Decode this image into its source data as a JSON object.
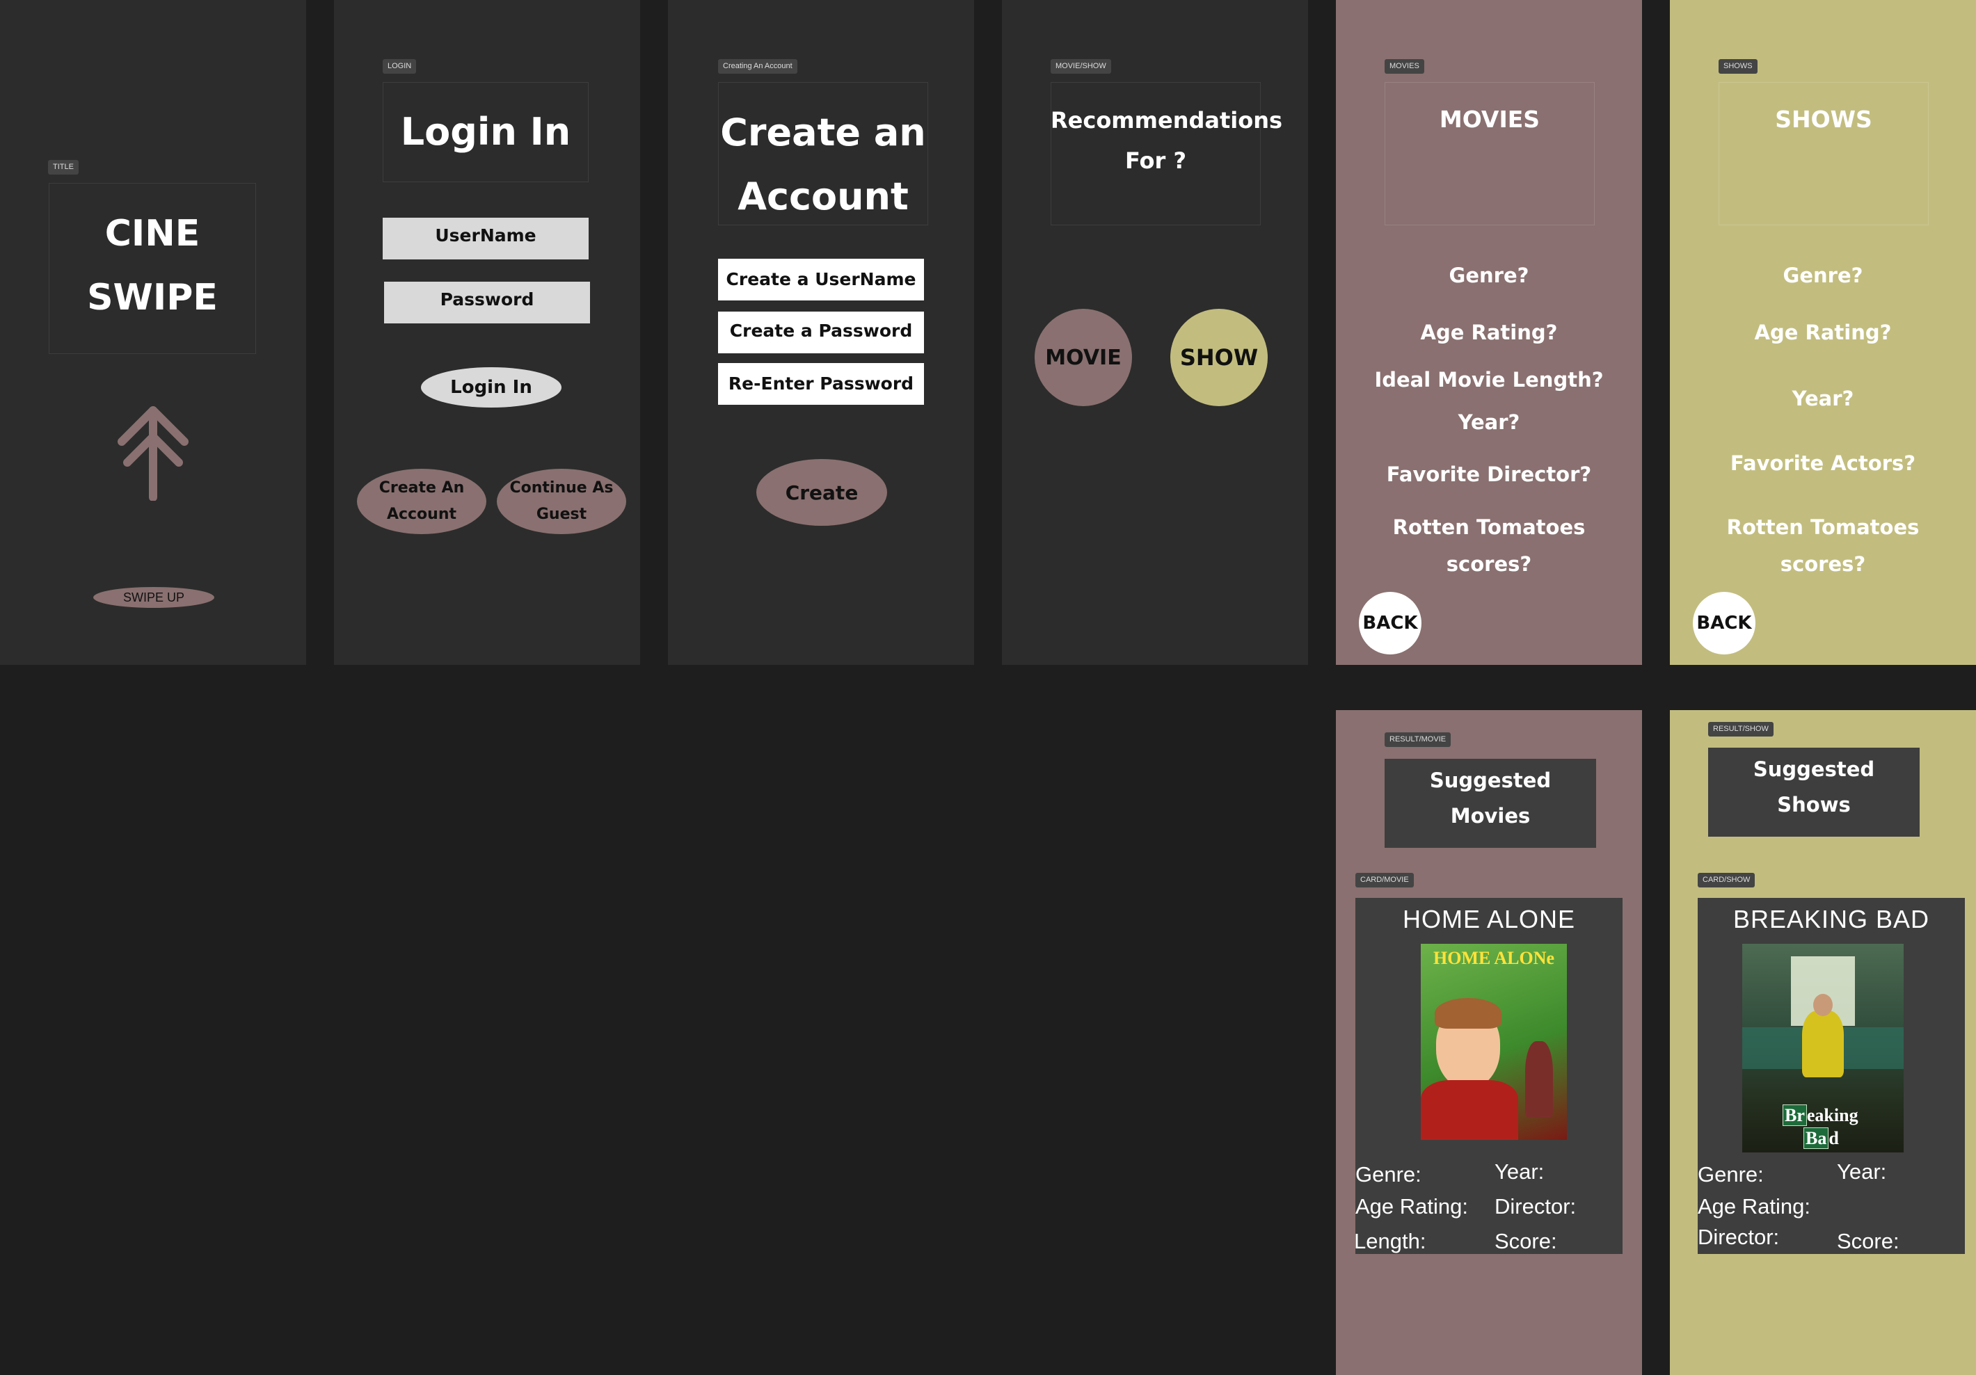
{
  "frames": {
    "title": {
      "tag": "TITLE",
      "heading": "CINE\nSWIPE",
      "swipe_label": "SWIPE UP"
    },
    "login": {
      "tag": "LOGIN",
      "heading": "Login In",
      "username_placeholder": "UserName",
      "password_placeholder": "Password",
      "login_label": "Login In",
      "create_label": "Create An\nAccount",
      "guest_label": "Continue As\nGuest"
    },
    "create_account": {
      "tag": "Creating An Account",
      "heading": "Create an\nAccount",
      "username_placeholder": "Create a UserName",
      "password_placeholder": "Create a Password",
      "reenter_placeholder": "Re-Enter Password",
      "create_label": "Create"
    },
    "movie_show": {
      "tag": "MOVIE/SHOW",
      "heading": "Recommendations\nFor ?",
      "movie_label": "MOVIE",
      "show_label": "SHOW"
    },
    "movies": {
      "tag": "MOVIES",
      "heading": "MOVIES",
      "questions": [
        "Genre?",
        "Age Rating?",
        "Ideal Movie Length?",
        "Year?",
        "Favorite Director?",
        "Rotten Tomatoes\nscores?"
      ],
      "back_label": "BACK"
    },
    "shows": {
      "tag": "SHOWS",
      "heading": "SHOWS",
      "questions": [
        "Genre?",
        "Age Rating?",
        "Year?",
        "Favorite Actors?",
        "Rotten Tomatoes\nscores?"
      ],
      "back_label": "BACK"
    },
    "result_movie": {
      "tag": "RESULT/MOVIE",
      "heading": "Suggested\nMovies",
      "card_tag": "CARD/MOVIE",
      "card_title": "HOME ALONE",
      "poster_text": "HOME ALONe",
      "meta": {
        "genre": "Genre:",
        "year": "Year:",
        "age_rating": "Age Rating:",
        "director": "Director:",
        "length": "Length:",
        "score": "Score:"
      }
    },
    "result_show": {
      "tag": "RESULT/SHOW",
      "heading": "Suggested\nShows",
      "card_tag": "CARD/SHOW",
      "card_title": "BREAKING BAD",
      "poster_text_1": "Br",
      "poster_text_1b": "eaking",
      "poster_text_2": "Ba",
      "poster_text_2b": "d",
      "meta": {
        "genre": "Genre:",
        "year": "Year:",
        "age_rating": "Age Rating:",
        "director": "Director:",
        "score": "Score:"
      }
    }
  },
  "colors": {
    "canvas": "#1e1e1e",
    "dark_frame": "#2c2c2c",
    "mauve": "#8a7070",
    "olive": "#c2bd7f",
    "input_gray": "#d9d9d9",
    "card_gray": "#3e3e3e"
  },
  "icons": {
    "title_arrow": "arrow-up-icon"
  }
}
